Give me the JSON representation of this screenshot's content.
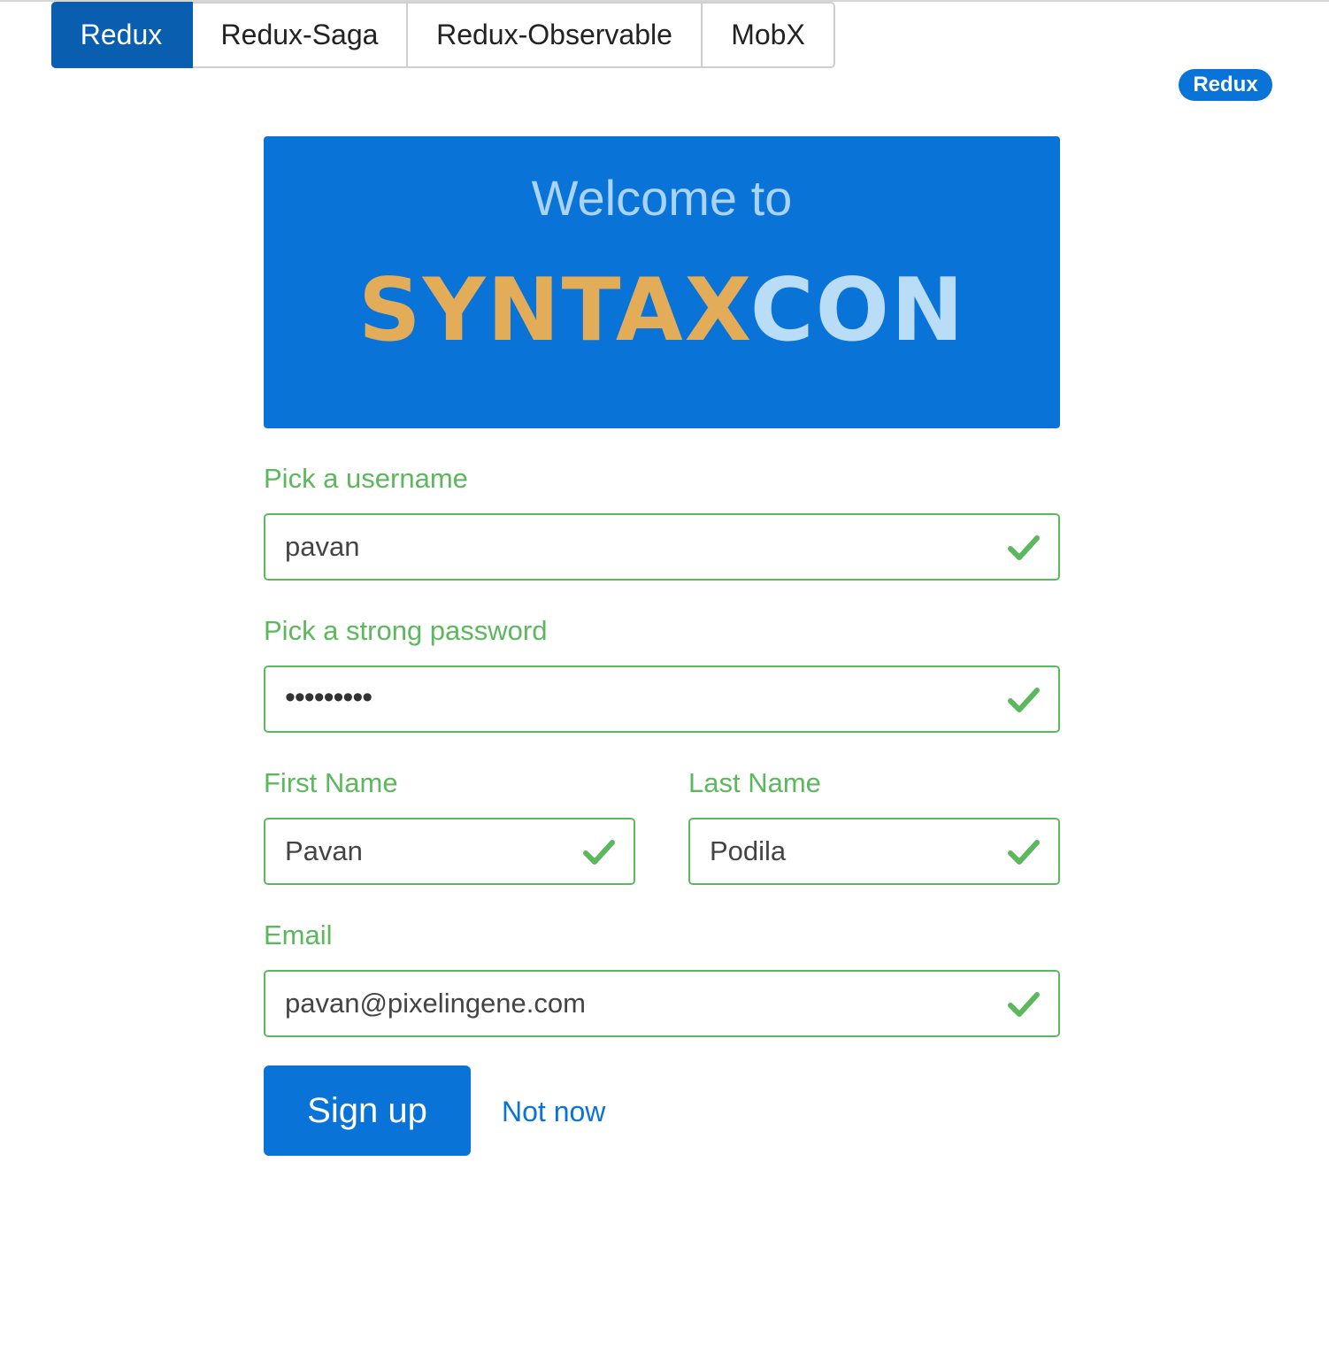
{
  "tabs": [
    {
      "label": "Redux",
      "active": true
    },
    {
      "label": "Redux-Saga",
      "active": false
    },
    {
      "label": "Redux-Observable",
      "active": false
    },
    {
      "label": "MobX",
      "active": false
    }
  ],
  "badge": {
    "label": "Redux"
  },
  "banner": {
    "welcome": "Welcome to",
    "logo_part1": "SYNTAX",
    "logo_part2": "CON"
  },
  "form": {
    "username": {
      "label": "Pick a username",
      "value": "pavan",
      "valid": true
    },
    "password": {
      "label": "Pick a strong password",
      "masked_value": "•••••••••",
      "valid": true
    },
    "first_name": {
      "label": "First Name",
      "value": "Pavan",
      "valid": true
    },
    "last_name": {
      "label": "Last Name",
      "value": "Podila",
      "valid": true
    },
    "email": {
      "label": "Email",
      "value": "pavan@pixelingene.com",
      "valid": true
    }
  },
  "actions": {
    "signup_label": "Sign up",
    "not_now_label": "Not now"
  },
  "colors": {
    "primary": "#0a73d8",
    "active_tab": "#0a5eb0",
    "success": "#5cb85c",
    "logo_gold": "#e2ac58",
    "logo_light_blue": "#b9dcf7"
  },
  "icons": {
    "valid": "check-icon"
  }
}
